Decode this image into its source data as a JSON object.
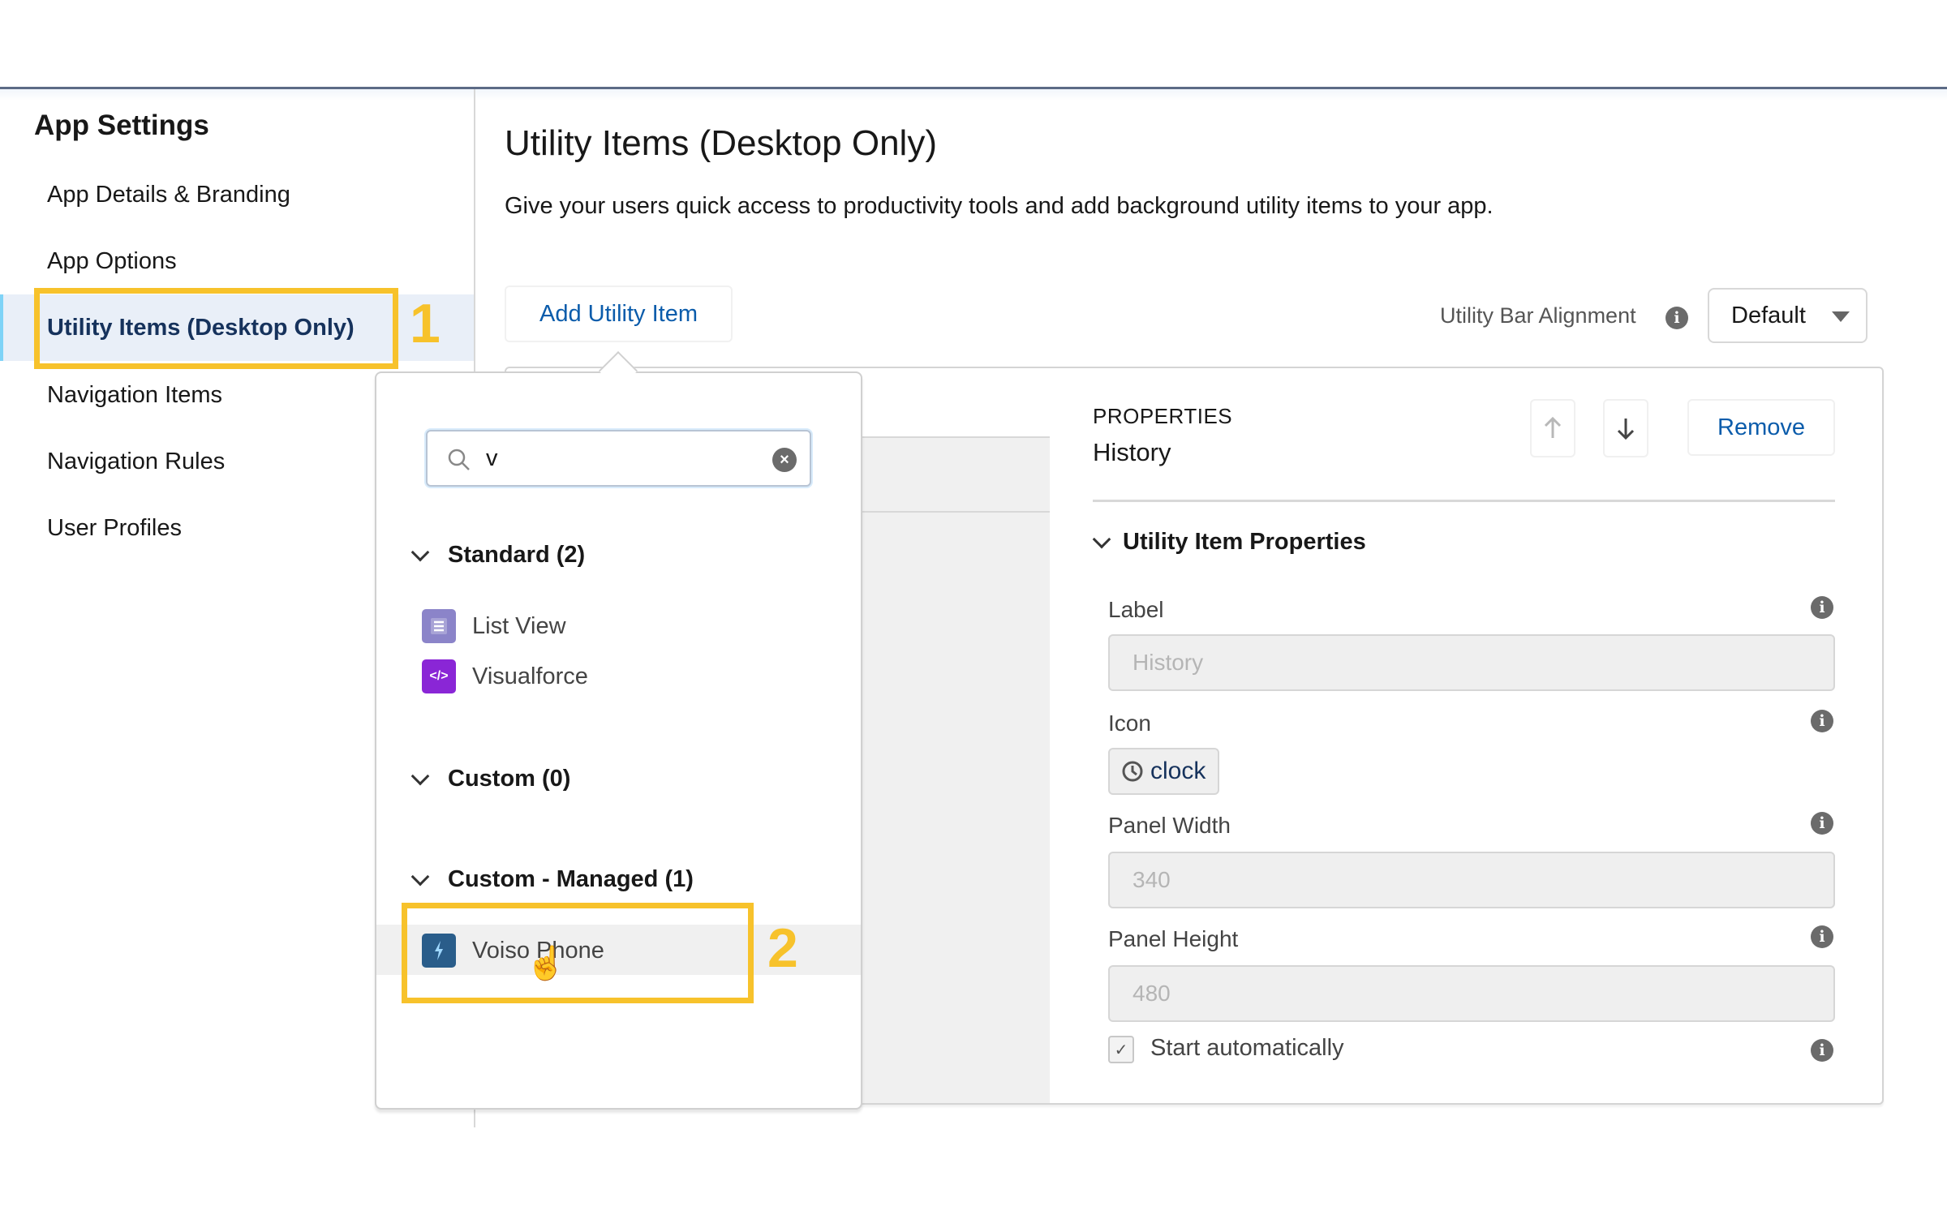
{
  "sidebar": {
    "title": "App Settings",
    "items": [
      {
        "label": "App Details & Branding",
        "active": false
      },
      {
        "label": "App Options",
        "active": false
      },
      {
        "label": "Utility Items (Desktop Only)",
        "active": true
      },
      {
        "label": "Navigation Items",
        "active": false
      },
      {
        "label": "Navigation Rules",
        "active": false
      },
      {
        "label": "User Profiles",
        "active": false
      }
    ]
  },
  "annotations": {
    "step1": "1",
    "step2": "2",
    "color": "#f7c22b"
  },
  "header": {
    "title": "Utility Items (Desktop Only)",
    "description": "Give your users quick access to productivity tools and add background utility items to your app."
  },
  "toolbar": {
    "add_label": "Add Utility Item",
    "alignment_label": "Utility Bar Alignment",
    "alignment_value": "Default",
    "info_glyph": "i"
  },
  "picker": {
    "search_value": "v",
    "clear_glyph": "×",
    "groups": [
      {
        "label": "Standard (2)",
        "items": [
          {
            "label": "List View",
            "icon": "list-view-icon",
            "color": "#7f78c6"
          },
          {
            "label": "Visualforce",
            "icon": "code-icon",
            "color": "#8a26d6",
            "glyph": "</>"
          }
        ]
      },
      {
        "label": "Custom (0)",
        "items": []
      },
      {
        "label": "Custom - Managed (1)",
        "items": [
          {
            "label": "Voiso Phone",
            "icon": "lightning-icon",
            "color": "#2a5d8a",
            "hovered": true
          }
        ]
      }
    ]
  },
  "properties": {
    "kicker": "PROPERTIES",
    "item_name": "History",
    "remove_label": "Remove",
    "section_title": "Utility Item Properties",
    "fields": {
      "label_label": "Label",
      "label_value": "History",
      "icon_label": "Icon",
      "icon_value": "clock",
      "width_label": "Panel Width",
      "width_value": "340",
      "height_label": "Panel Height",
      "height_value": "480",
      "start_label": "Start automatically",
      "start_checked": true
    }
  },
  "colors": {
    "link": "#0b5cab",
    "active_nav_bg": "#e9eff8"
  }
}
